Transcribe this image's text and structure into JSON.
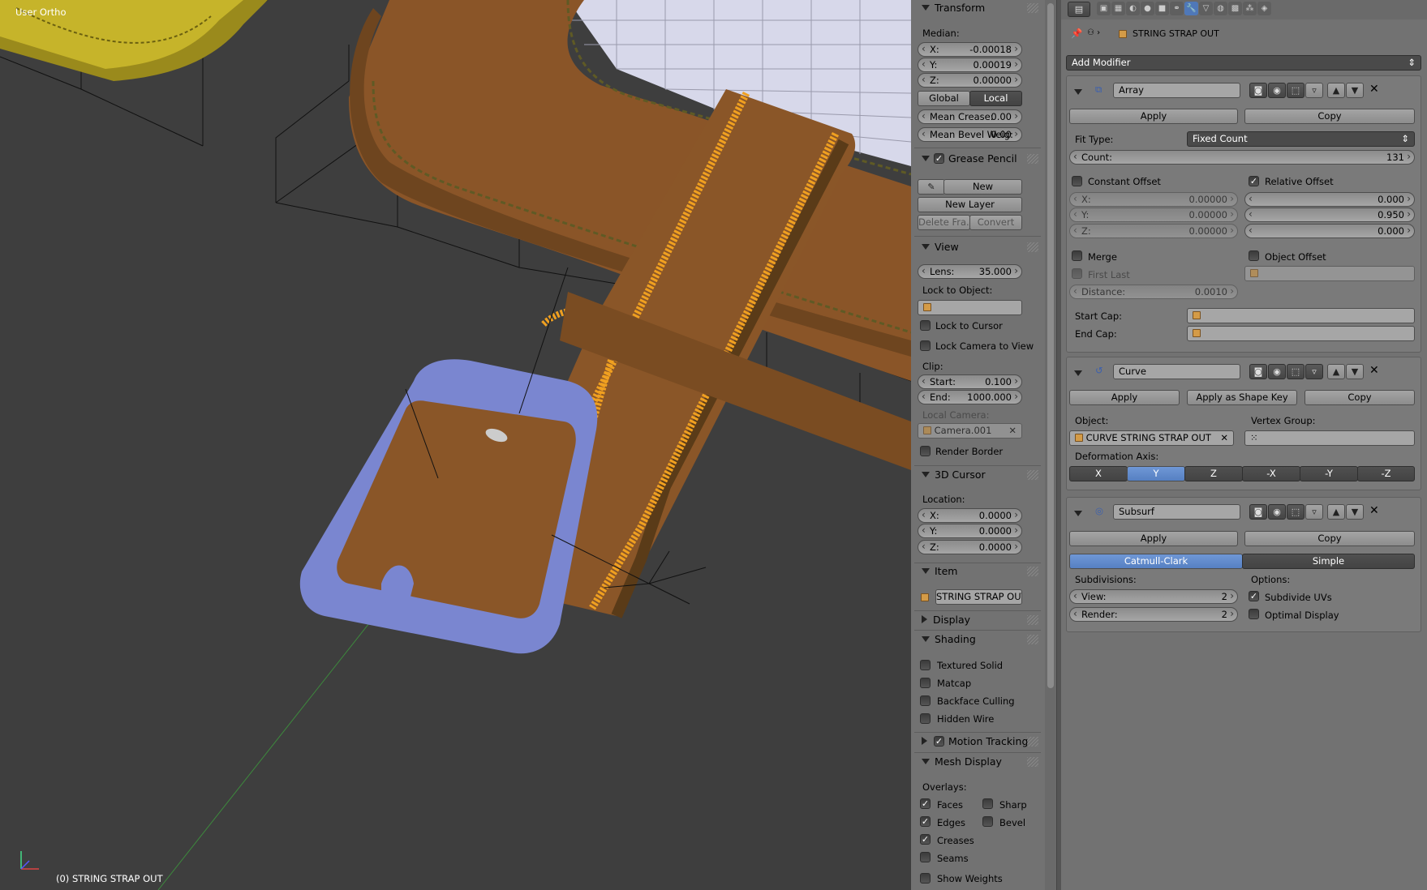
{
  "viewport": {
    "title": "User Ortho",
    "object_label": "(0) STRING STRAP OUT"
  },
  "npanel": {
    "transform": {
      "header": "Transform",
      "median_label": "Median:",
      "x": {
        "label": "X:",
        "value": "-0.00018"
      },
      "y": {
        "label": "Y:",
        "value": "0.00019"
      },
      "z": {
        "label": "Z:",
        "value": "0.00000"
      },
      "global": "Global",
      "local": "Local",
      "mean_crease": {
        "label": "Mean Crease:",
        "value": "0.00"
      },
      "mean_bevel": {
        "label": "Mean Bevel Weig:",
        "value": "0.00"
      }
    },
    "grease_pencil": {
      "header": "Grease Pencil",
      "new": "New",
      "new_layer": "New Layer",
      "delete_frame": "Delete Fra...",
      "convert": "Convert"
    },
    "view": {
      "header": "View",
      "lens": {
        "label": "Lens:",
        "value": "35.000"
      },
      "lock_to_object": "Lock to Object:",
      "lock_to_cursor": "Lock to Cursor",
      "lock_camera": "Lock Camera to View",
      "clip": "Clip:",
      "start": {
        "label": "Start:",
        "value": "0.100"
      },
      "end": {
        "label": "End:",
        "value": "1000.000"
      },
      "local_camera": "Local Camera:",
      "camera": "Camera.001",
      "render_border": "Render Border"
    },
    "cursor": {
      "header": "3D Cursor",
      "location": "Location:",
      "x": {
        "label": "X:",
        "value": "0.0000"
      },
      "y": {
        "label": "Y:",
        "value": "0.0000"
      },
      "z": {
        "label": "Z:",
        "value": "0.0000"
      }
    },
    "item": {
      "header": "Item",
      "name": "STRING STRAP OUT"
    },
    "display": {
      "header": "Display"
    },
    "shading": {
      "header": "Shading",
      "textured_solid": "Textured Solid",
      "matcap": "Matcap",
      "backface": "Backface Culling",
      "hidden_wire": "Hidden Wire"
    },
    "motion_tracking": {
      "header": "Motion Tracking"
    },
    "mesh_display": {
      "header": "Mesh Display",
      "overlays": "Overlays:",
      "faces": "Faces",
      "sharp": "Sharp",
      "edges": "Edges",
      "bevel": "Bevel",
      "creases": "Creases",
      "seams": "Seams",
      "show_weights": "Show Weights"
    }
  },
  "props": {
    "object_name": "STRING STRAP OUT",
    "add_modifier": "Add Modifier",
    "array": {
      "name": "Array",
      "apply": "Apply",
      "copy": "Copy",
      "fit_type_label": "Fit Type:",
      "fit_type": "Fixed Count",
      "count": {
        "label": "Count:",
        "value": "131"
      },
      "constant_offset": "Constant Offset",
      "relative_offset": "Relative Offset",
      "cx": {
        "label": "X:",
        "value": "0.00000"
      },
      "cy": {
        "label": "Y:",
        "value": "0.00000"
      },
      "cz": {
        "label": "Z:",
        "value": "0.00000"
      },
      "rx": "0.000",
      "ry": "0.950",
      "rz": "0.000",
      "merge": "Merge",
      "object_offset": "Object Offset",
      "first_last": "First Last",
      "distance": {
        "label": "Distance:",
        "value": "0.0010"
      },
      "start_cap": "Start Cap:",
      "end_cap": "End Cap:"
    },
    "curve": {
      "name": "Curve",
      "apply": "Apply",
      "apply_shape": "Apply as Shape Key",
      "copy": "Copy",
      "object_label": "Object:",
      "object": "CURVE STRING STRAP OUT",
      "vgroup_label": "Vertex Group:",
      "deform_label": "Deformation Axis:",
      "axes": [
        "X",
        "Y",
        "Z",
        "-X",
        "-Y",
        "-Z"
      ]
    },
    "subsurf": {
      "name": "Subsurf",
      "apply": "Apply",
      "copy": "Copy",
      "catmull": "Catmull-Clark",
      "simple": "Simple",
      "subdivisions": "Subdivisions:",
      "options": "Options:",
      "view": {
        "label": "View:",
        "value": "2"
      },
      "render": {
        "label": "Render:",
        "value": "2"
      },
      "subdivide_uvs": "Subdivide UVs",
      "optimal_display": "Optimal Display"
    }
  }
}
